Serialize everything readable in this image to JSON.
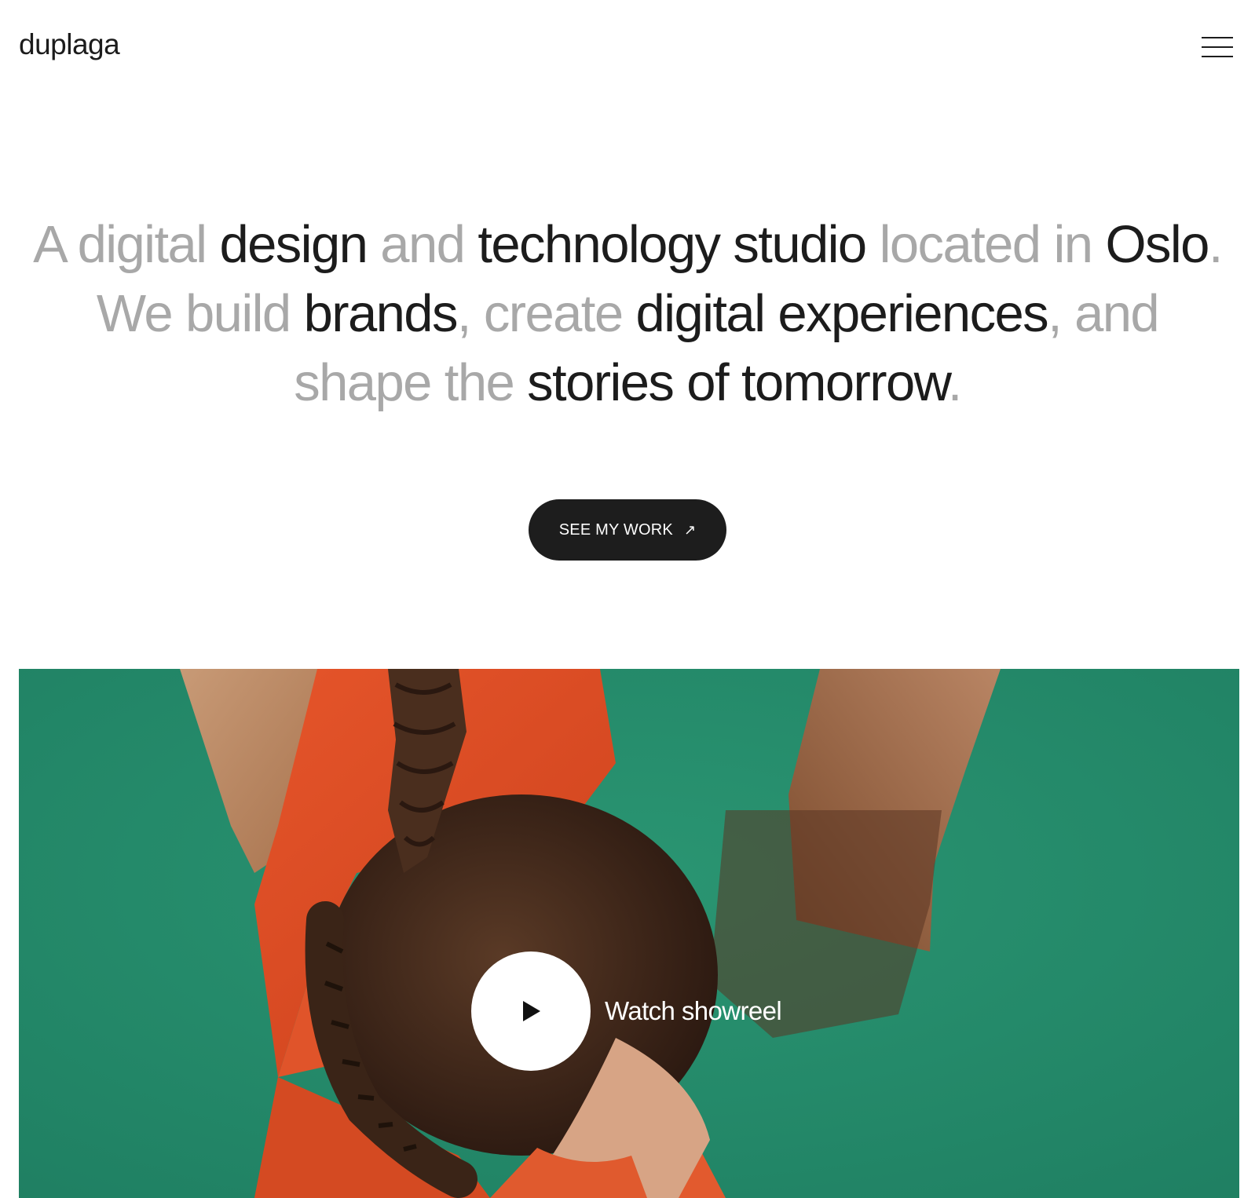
{
  "header": {
    "logo_text": "duplaga",
    "menu_icon": "hamburger-menu-icon"
  },
  "hero": {
    "headline": [
      {
        "text": "A digital ",
        "tone": "muted"
      },
      {
        "text": "design ",
        "tone": "strong"
      },
      {
        "text": "and ",
        "tone": "muted"
      },
      {
        "text": "technology studio ",
        "tone": "strong"
      },
      {
        "text": "located in ",
        "tone": "muted"
      },
      {
        "text": "Oslo",
        "tone": "strong"
      },
      {
        "text": ".",
        "tone": "muted"
      },
      {
        "text": "\n",
        "tone": "break"
      },
      {
        "text": "We build ",
        "tone": "muted"
      },
      {
        "text": "brands",
        "tone": "strong"
      },
      {
        "text": ", create ",
        "tone": "muted"
      },
      {
        "text": "digital experiences",
        "tone": "strong"
      },
      {
        "text": ", and",
        "tone": "muted"
      },
      {
        "text": "\n",
        "tone": "break"
      },
      {
        "text": "shape the ",
        "tone": "muted"
      },
      {
        "text": "stories of tomorrow",
        "tone": "strong"
      },
      {
        "text": ".",
        "tone": "muted"
      }
    ],
    "cta_label": "SEE MY WORK",
    "cta_icon": "arrow-up-right-icon"
  },
  "media": {
    "play_icon": "play-icon",
    "play_label": "Watch showreel"
  },
  "colors": {
    "text_strong": "#1c1c1c",
    "text_muted": "#a8a8a8",
    "button_bg": "#1d1d1d",
    "media_bg": "#23896a",
    "shirt": "#e04a22"
  }
}
